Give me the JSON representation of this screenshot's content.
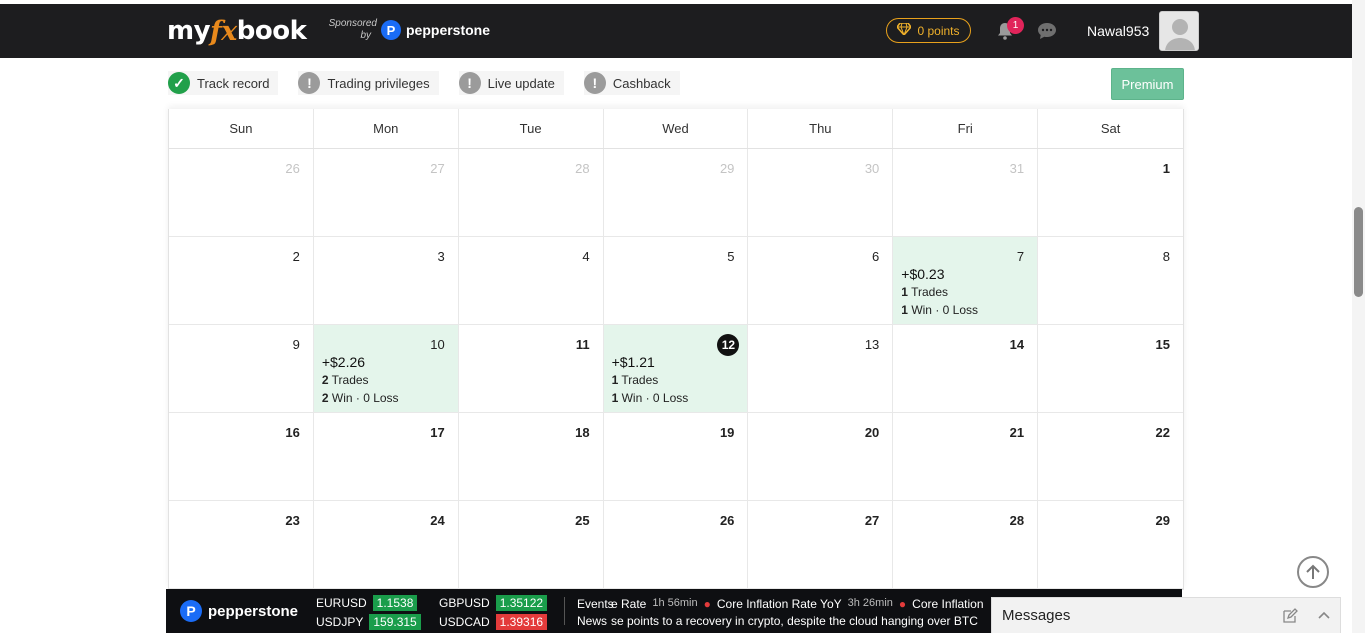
{
  "header": {
    "logo_my": "my",
    "logo_fx": "fx",
    "logo_book": "book",
    "sponsored_line1": "Sponsored",
    "sponsored_line2": "by",
    "sponsor_name": "pepperstone",
    "sponsor_mark": "P",
    "points_label": "0 points",
    "notification_count": "1",
    "username": "Nawal953"
  },
  "status": {
    "items": [
      {
        "label": "Track record",
        "state": "ok",
        "glyph": "✓"
      },
      {
        "label": "Trading privileges",
        "state": "warn",
        "glyph": "!"
      },
      {
        "label": "Live update",
        "state": "warn",
        "glyph": "!"
      },
      {
        "label": "Cashback",
        "state": "warn",
        "glyph": "!"
      }
    ],
    "premium_label": "Premium"
  },
  "calendar": {
    "weekdays": [
      "Sun",
      "Mon",
      "Tue",
      "Wed",
      "Thu",
      "Fri",
      "Sat"
    ],
    "days": [
      {
        "n": "26",
        "muted": true
      },
      {
        "n": "27",
        "muted": true
      },
      {
        "n": "28",
        "muted": true
      },
      {
        "n": "29",
        "muted": true
      },
      {
        "n": "30",
        "muted": true
      },
      {
        "n": "31",
        "muted": true
      },
      {
        "n": "1",
        "bold": true
      },
      {
        "n": "2"
      },
      {
        "n": "3"
      },
      {
        "n": "4"
      },
      {
        "n": "5"
      },
      {
        "n": "6"
      },
      {
        "n": "7",
        "profit": true,
        "amount": "+$0.23",
        "trades": "1",
        "trades_label": "Trades",
        "wins": "1",
        "win_label": "Win · 0 Loss"
      },
      {
        "n": "8"
      },
      {
        "n": "9"
      },
      {
        "n": "10",
        "profit": true,
        "amount": "+$2.26",
        "trades": "2",
        "trades_label": "Trades",
        "wins": "2",
        "win_label": "Win · 0 Loss"
      },
      {
        "n": "11",
        "bold": true
      },
      {
        "n": "12",
        "today": true,
        "profit": true,
        "amount": "+$1.21",
        "trades": "1",
        "trades_label": "Trades",
        "wins": "1",
        "win_label": "Win · 0 Loss"
      },
      {
        "n": "13"
      },
      {
        "n": "14",
        "bold": true
      },
      {
        "n": "15",
        "bold": true
      },
      {
        "n": "16",
        "bold": true
      },
      {
        "n": "17",
        "bold": true
      },
      {
        "n": "18",
        "bold": true
      },
      {
        "n": "19",
        "bold": true
      },
      {
        "n": "20",
        "bold": true
      },
      {
        "n": "21",
        "bold": true
      },
      {
        "n": "22",
        "bold": true
      },
      {
        "n": "23",
        "bold": true
      },
      {
        "n": "24",
        "bold": true
      },
      {
        "n": "25",
        "bold": true
      },
      {
        "n": "26",
        "bold": true
      },
      {
        "n": "27",
        "bold": true
      },
      {
        "n": "28",
        "bold": true
      },
      {
        "n": "29",
        "bold": true
      }
    ]
  },
  "ticker": {
    "brand": "pepperstone",
    "quotes": [
      {
        "pair": "EURUSD",
        "value": "1.1538",
        "dir": "green"
      },
      {
        "pair": "GBPUSD",
        "value": "1.35122",
        "dir": "green"
      },
      {
        "pair": "USDJPY",
        "value": "159.315",
        "dir": "green"
      },
      {
        "pair": "USDCAD",
        "value": "1.39316",
        "dir": "red"
      }
    ],
    "events_label": "Events",
    "events": [
      {
        "name": "e Rate",
        "time": "1h 56min"
      },
      {
        "name": "Core Inflation Rate YoY",
        "time": "3h 26min"
      },
      {
        "name": "Core Inflation",
        "time": ""
      }
    ],
    "news_label": "News",
    "news_text": "se points to a recovery in crypto, despite the cloud hanging over BTC"
  },
  "messages": {
    "title": "Messages"
  },
  "colors": {
    "header_bg": "#1d1d1f",
    "accent_orange": "#e8891c",
    "points_gold": "#f0b12b",
    "profit_bg": "#e4f5eb",
    "premium_green": "#6cc19a",
    "quote_green": "#1a9d4b",
    "quote_red": "#e33b3b"
  }
}
